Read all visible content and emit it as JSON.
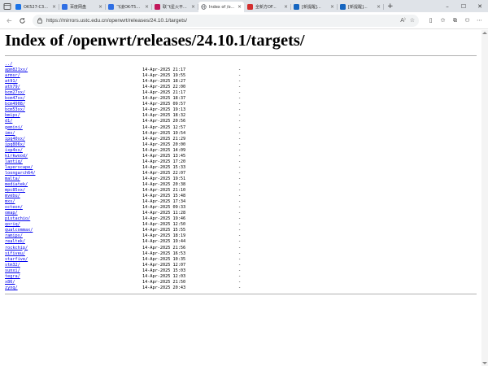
{
  "browser": {
    "tabs": [
      {
        "title": "OK527-C3...",
        "favicon_color": "#1a73e8",
        "favicon_glyph": "▪",
        "active": false
      },
      {
        "title": "百度网盘",
        "favicon_color": "#2f6fe4",
        "favicon_glyph": "▪",
        "active": false
      },
      {
        "title": "飞凌OK-T5...",
        "favicon_color": "#2f6fe4",
        "favicon_glyph": "▪",
        "active": false
      },
      {
        "title": "联飞星火平...",
        "favicon_color": "#c2185b",
        "favicon_glyph": "▪",
        "active": false
      },
      {
        "title": "Index of /o...",
        "favicon_color": "#5f6368",
        "favicon_glyph": "globe",
        "active": true
      },
      {
        "title": "全新方OF...",
        "favicon_color": "#d32f2f",
        "favicon_glyph": "▪",
        "active": false
      },
      {
        "title": "[新提醒]...",
        "favicon_color": "#1565c0",
        "favicon_glyph": "▪",
        "active": false
      },
      {
        "title": "[新提醒]...",
        "favicon_color": "#1565c0",
        "favicon_glyph": "▪",
        "active": false
      }
    ],
    "new_tab_label": "+",
    "window_controls": {
      "minimize": "–",
      "maximize": "☐",
      "close": "✕"
    },
    "address": {
      "url": "https://mirrors.ustc.edu.cn/openwrt/releases/24.10.1/targets/",
      "read_aloud_icon": "read-aloud-icon",
      "favorite_icon": "star-icon"
    },
    "toolbar_icons": [
      "split-screen-icon",
      "favorites-icon",
      "collections-icon",
      "extensions-icon",
      "more-icon"
    ]
  },
  "page": {
    "heading": "Index of /openwrt/releases/24.10.1/targets/",
    "entries": [
      {
        "name": "../",
        "date": "",
        "size": ""
      },
      {
        "name": "apm821xx/",
        "date": "14-Apr-2025 21:17",
        "size": "-"
      },
      {
        "name": "armsr/",
        "date": "14-Apr-2025 19:55",
        "size": "-"
      },
      {
        "name": "at91/",
        "date": "14-Apr-2025 18:27",
        "size": "-"
      },
      {
        "name": "ath79/",
        "date": "14-Apr-2025 22:00",
        "size": "-"
      },
      {
        "name": "bcm27xx/",
        "date": "14-Apr-2025 21:17",
        "size": "-"
      },
      {
        "name": "bcm47xx/",
        "date": "14-Apr-2025 18:37",
        "size": "-"
      },
      {
        "name": "bcm4908/",
        "date": "14-Apr-2025 09:57",
        "size": "-"
      },
      {
        "name": "bcm53xx/",
        "date": "14-Apr-2025 19:13",
        "size": "-"
      },
      {
        "name": "bmips/",
        "date": "14-Apr-2025 18:32",
        "size": "-"
      },
      {
        "name": "d1/",
        "date": "14-Apr-2025 20:56",
        "size": "-"
      },
      {
        "name": "gemini/",
        "date": "14-Apr-2025 12:57",
        "size": "-"
      },
      {
        "name": "imx/",
        "date": "14-Apr-2025 19:54",
        "size": "-"
      },
      {
        "name": "ipq40xx/",
        "date": "14-Apr-2025 21:29",
        "size": "-"
      },
      {
        "name": "ipq806x/",
        "date": "14-Apr-2025 20:00",
        "size": "-"
      },
      {
        "name": "ixp4xx/",
        "date": "14-Apr-2025 14:09",
        "size": "-"
      },
      {
        "name": "kirkwood/",
        "date": "14-Apr-2025 13:45",
        "size": "-"
      },
      {
        "name": "lantiq/",
        "date": "14-Apr-2025 17:20",
        "size": "-"
      },
      {
        "name": "layerscape/",
        "date": "14-Apr-2025 15:33",
        "size": "-"
      },
      {
        "name": "loongarch64/",
        "date": "14-Apr-2025 22:07",
        "size": "-"
      },
      {
        "name": "malta/",
        "date": "14-Apr-2025 19:51",
        "size": "-"
      },
      {
        "name": "mediatek/",
        "date": "14-Apr-2025 20:38",
        "size": "-"
      },
      {
        "name": "mpc85xx/",
        "date": "14-Apr-2025 21:10",
        "size": "-"
      },
      {
        "name": "mvebu/",
        "date": "14-Apr-2025 15:48",
        "size": "-"
      },
      {
        "name": "mxs/",
        "date": "14-Apr-2025 17:34",
        "size": "-"
      },
      {
        "name": "octeon/",
        "date": "14-Apr-2025 09:33",
        "size": "-"
      },
      {
        "name": "omap/",
        "date": "14-Apr-2025 11:28",
        "size": "-"
      },
      {
        "name": "pistachio/",
        "date": "14-Apr-2025 19:46",
        "size": "-"
      },
      {
        "name": "qoriq/",
        "date": "14-Apr-2025 12:50",
        "size": "-"
      },
      {
        "name": "qualcommax/",
        "date": "14-Apr-2025 15:55",
        "size": "-"
      },
      {
        "name": "ramips/",
        "date": "14-Apr-2025 18:19",
        "size": "-"
      },
      {
        "name": "realtek/",
        "date": "14-Apr-2025 19:44",
        "size": "-"
      },
      {
        "name": "rockchip/",
        "date": "14-Apr-2025 21:56",
        "size": "-"
      },
      {
        "name": "sifiveu/",
        "date": "14-Apr-2025 16:53",
        "size": "-"
      },
      {
        "name": "starfive/",
        "date": "14-Apr-2025 10:35",
        "size": "-"
      },
      {
        "name": "stm32/",
        "date": "14-Apr-2025 12:07",
        "size": "-"
      },
      {
        "name": "sunxi/",
        "date": "14-Apr-2025 15:03",
        "size": "-"
      },
      {
        "name": "tegra/",
        "date": "14-Apr-2025 12:03",
        "size": "-"
      },
      {
        "name": "x86/",
        "date": "14-Apr-2025 21:50",
        "size": "-"
      },
      {
        "name": "zynq/",
        "date": "14-Apr-2025 20:43",
        "size": "-"
      }
    ]
  },
  "colors": {
    "link": "#0000ee",
    "tabbar_bg": "#dfe3e8",
    "omnibox_bg": "#f1f3f4"
  }
}
